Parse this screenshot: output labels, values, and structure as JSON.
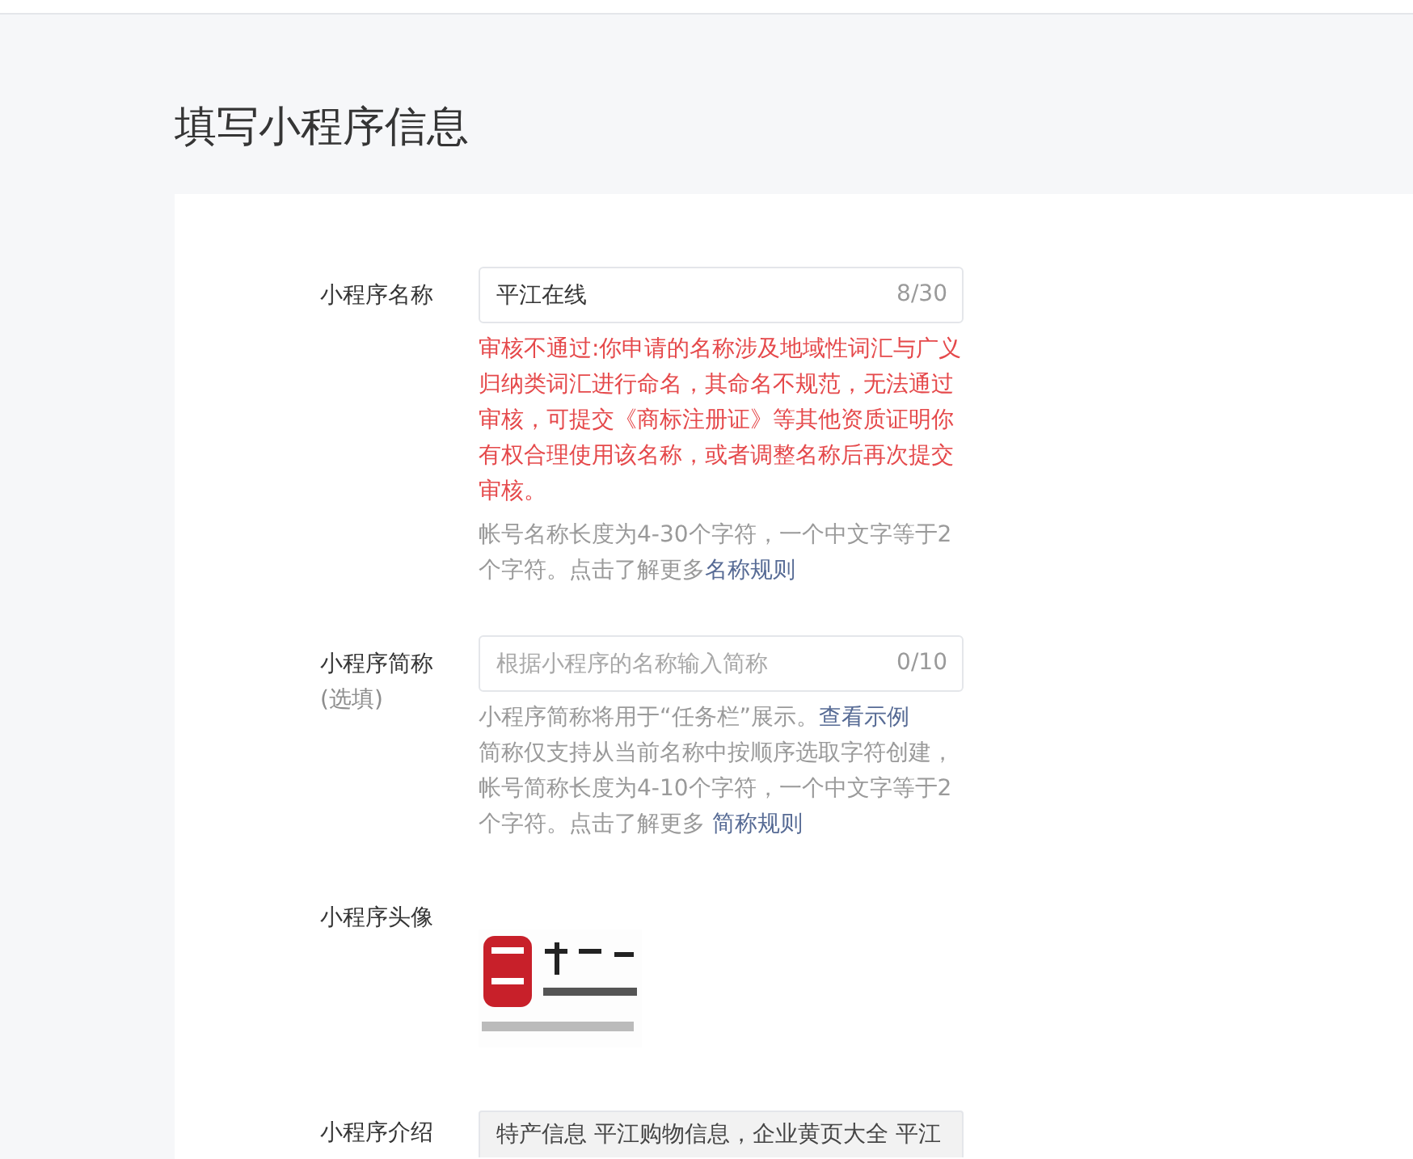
{
  "header": {
    "title": "填写小程序信息"
  },
  "form": {
    "fields": [
      {
        "kind": "text",
        "label": "小程序名称",
        "value": "平江在线",
        "counter": "8/30",
        "error": "审核不通过:你申请的名称涉及地域性词汇与广义归纳类词汇进行命名，其命名不规范，无法通过审核，可提交《商标注册证》等其他资质证明你有权合理使用该名称，或者调整名称后再次提交审核。",
        "hints": [
          {
            "text": "帐号名称长度为4-30个字符，一个中文字等于2个字符。点击了解更多",
            "link": "名称规则"
          }
        ]
      },
      {
        "kind": "text",
        "label": "小程序简称",
        "note": "(选填)",
        "placeholder": "根据小程序的名称输入简称",
        "counter": "0/10",
        "hints": [
          {
            "text": "小程序简称将用于“任务栏”展示。",
            "link": "查看示例"
          },
          {
            "text": "简称仅支持从当前名称中按顺序选取字符创建，帐号简称长度为4-10个字符，一个中文字等于2个字符。点击了解更多 ",
            "link": "简称规则"
          }
        ]
      },
      {
        "kind": "image",
        "label": "小程序头像"
      },
      {
        "kind": "textarea",
        "label": "小程序介绍",
        "value": "特产信息 平江购物信息，企业黄页大全 平江",
        "disabled": true
      }
    ]
  }
}
